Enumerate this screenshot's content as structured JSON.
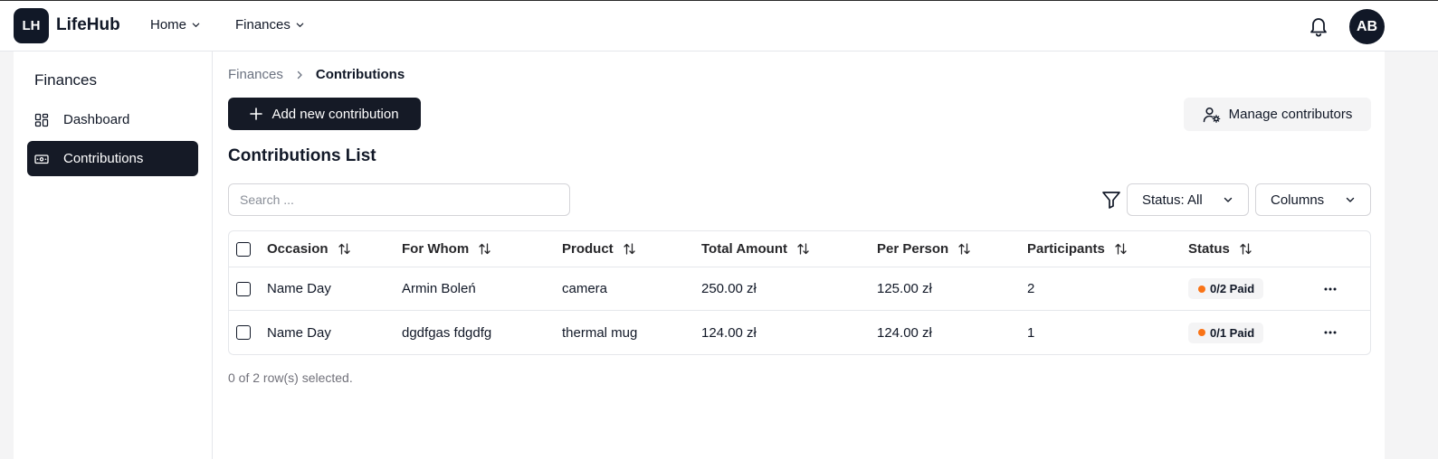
{
  "header": {
    "logo_text": "LH",
    "app_name": "LifeHub",
    "nav": [
      "Home",
      "Finances"
    ],
    "avatar_initials": "AB"
  },
  "sidebar": {
    "title": "Finances",
    "items": [
      {
        "label": "Dashboard",
        "icon": "dashboard-icon",
        "active": false
      },
      {
        "label": "Contributions",
        "icon": "banknote-icon",
        "active": true
      }
    ]
  },
  "breadcrumb": {
    "parent": "Finances",
    "current": "Contributions"
  },
  "actions": {
    "add_label": "Add new contribution",
    "manage_label": "Manage contributors"
  },
  "section_title": "Contributions List",
  "search": {
    "placeholder": "Search ...",
    "value": ""
  },
  "filters": {
    "status_label": "Status: All",
    "columns_label": "Columns"
  },
  "table": {
    "columns": [
      "Occasion",
      "For Whom",
      "Product",
      "Total Amount",
      "Per Person",
      "Participants",
      "Status"
    ],
    "rows": [
      {
        "occasion": "Name Day",
        "for_whom": "Armin Boleń",
        "product": "camera",
        "total": "250.00 zł",
        "per_person": "125.00 zł",
        "participants": "2",
        "status": "0/2 Paid"
      },
      {
        "occasion": "Name Day",
        "for_whom": "dgdfgas fdgdfg",
        "product": "thermal mug",
        "total": "124.00 zł",
        "per_person": "124.00 zł",
        "participants": "1",
        "status": "0/1 Paid"
      }
    ]
  },
  "footer": {
    "selected_info": "0 of 2 row(s) selected."
  },
  "colors": {
    "primary": "#151a26",
    "status_dot": "#f97316",
    "muted_bg": "#f4f4f5"
  }
}
